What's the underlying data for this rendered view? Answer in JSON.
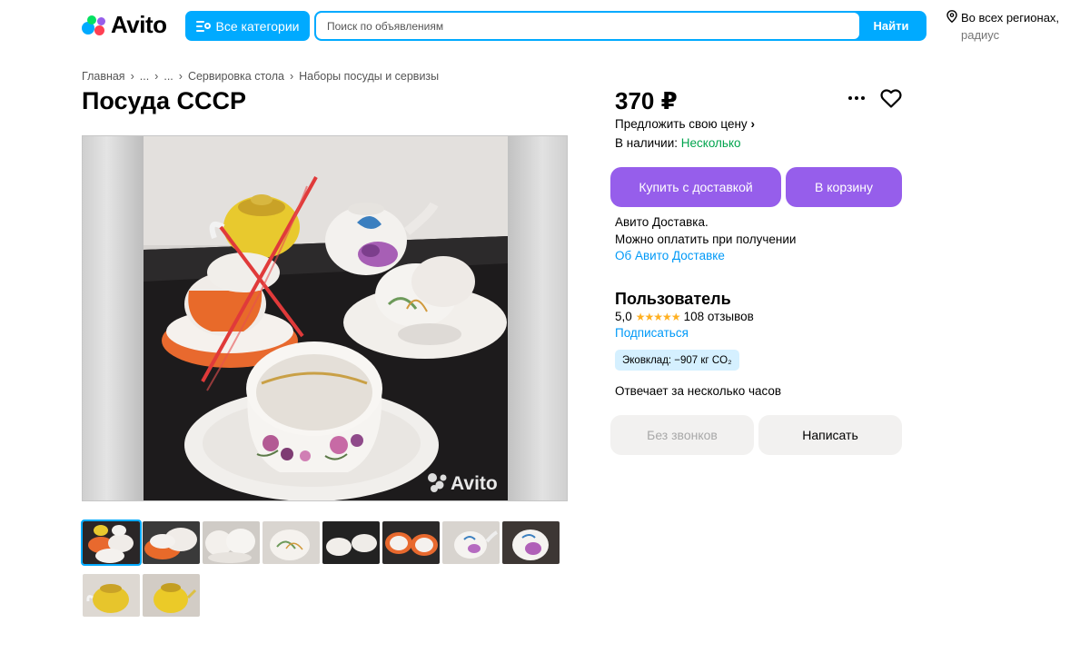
{
  "header": {
    "logo_text": "Avito",
    "categories_label": "Все категории",
    "search_placeholder": "Поиск по объявлениям",
    "search_button": "Найти",
    "region_line1": "Во всех регионах,",
    "region_line2": "радиус"
  },
  "breadcrumb": [
    "Главная",
    "...",
    "...",
    "Сервировка стола",
    "Наборы посуды и сервизы"
  ],
  "listing": {
    "title": "Посуда СССР",
    "price": "370 ₽",
    "offer_price": "Предложить свою цену",
    "stock_label": "В наличии:",
    "stock_value": "Несколько",
    "buy_delivery": "Купить с доставкой",
    "to_cart": "В корзину",
    "delivery_line1": "Авито Доставка.",
    "delivery_line2": "Можно оплатить при получении",
    "delivery_link": "Об Авито Доставке",
    "watermark": "Avito"
  },
  "seller": {
    "name": "Пользователь",
    "rating": "5,0",
    "stars": "★★★★★",
    "reviews": "108 отзывов",
    "subscribe": "Подписаться",
    "eco": "Эковклад: −907 кг CO₂",
    "responds": "Отвечает за несколько часов",
    "no_calls": "Без звонков",
    "write": "Написать"
  },
  "colors": {
    "accent_blue": "#00aaff",
    "purple": "#965eeb",
    "green": "#02a44e",
    "link": "#0099f7"
  },
  "thumbnails_count": 10
}
